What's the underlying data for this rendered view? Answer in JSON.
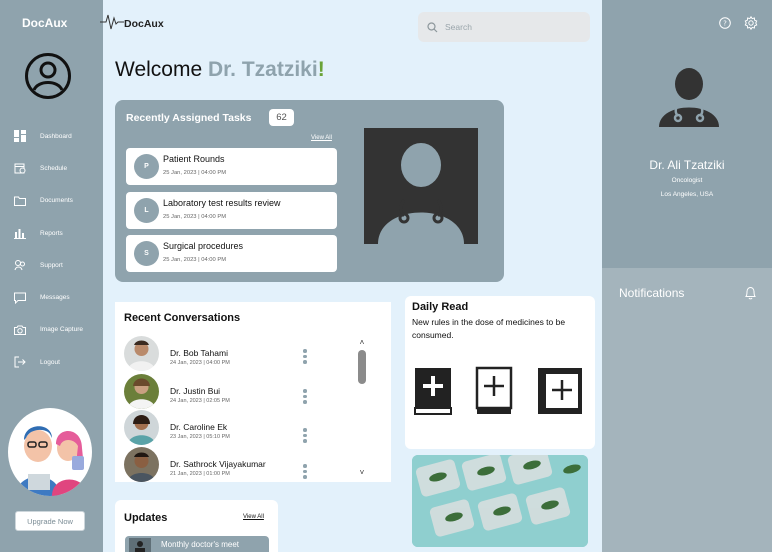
{
  "sidebar": {
    "logo": "DocAux",
    "items": [
      {
        "label": "Dashboard",
        "icon": "dashboard-icon"
      },
      {
        "label": "Schedule",
        "icon": "calendar-icon"
      },
      {
        "label": "Documents",
        "icon": "folder-icon"
      },
      {
        "label": "Reports",
        "icon": "bar-chart-icon"
      },
      {
        "label": "Support",
        "icon": "support-icon"
      },
      {
        "label": "Messages",
        "icon": "chat-icon"
      },
      {
        "label": "Image Capture",
        "icon": "camera-icon"
      },
      {
        "label": "Logout",
        "icon": "logout-icon"
      }
    ],
    "upgrade_label": "Upgrade Now"
  },
  "header": {
    "brand": "DocAux",
    "search_placeholder": "Search"
  },
  "welcome": {
    "prefix": "Welcome ",
    "name": "Dr. Tzatziki",
    "suffix": "!"
  },
  "tasks": {
    "title": "Recently Assigned Tasks",
    "count": "62",
    "view_all": "View All",
    "items": [
      {
        "initial": "P",
        "title": "Patient Rounds",
        "date": "25 Jan, 2023   |   04:00 PM"
      },
      {
        "initial": "L",
        "title": "Laboratory test results review",
        "date": "25 Jan, 2023   |   04:00 PM"
      },
      {
        "initial": "S",
        "title": "Surgical procedures",
        "date": "25 Jan, 2023   |   04:00 PM"
      }
    ]
  },
  "conversations": {
    "title": "Recent Conversations",
    "items": [
      {
        "name": "Dr. Bob Tahami",
        "date": "24 Jan, 2023   |   04:00 PM"
      },
      {
        "name": "Dr. Justin Bui",
        "date": "24 Jan, 2023   |   02:05 PM"
      },
      {
        "name": "Dr. Caroline Ek",
        "date": "23 Jan, 2023   |   05:10 PM"
      },
      {
        "name": "Dr. Sathrock Vijayakumar",
        "date": "21 Jan, 2023   |   01:00 PM"
      }
    ]
  },
  "daily_read": {
    "title": "Daily Read",
    "text": "New rules in the dose of medicines to be consumed."
  },
  "updates": {
    "title": "Updates",
    "view_all": "View All",
    "item": "Monthly doctor's meet"
  },
  "profile": {
    "name": "Dr. Ali Tzatziki",
    "specialty": "Oncologist",
    "location": "Los Angeles, USA"
  },
  "notifications": {
    "title": "Notifications"
  },
  "colors": {
    "accent": "#8fa3ad",
    "background": "#e3f1fb",
    "highlight": "#6aa338"
  }
}
